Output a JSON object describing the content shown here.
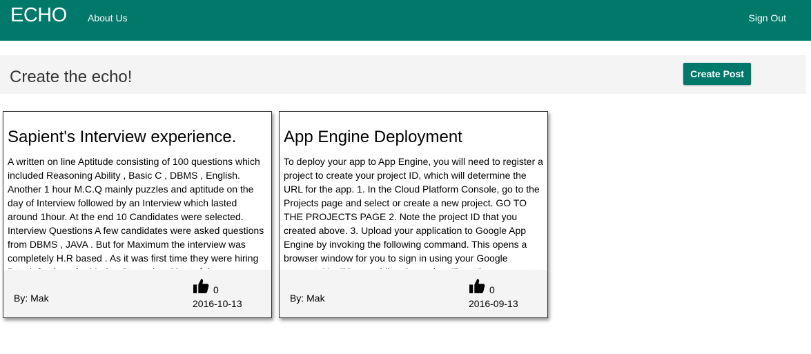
{
  "navbar": {
    "brand": "ECHO",
    "about_label": "About Us",
    "signout_label": "Sign Out",
    "color": "#00796b"
  },
  "header": {
    "title": "Create the echo!",
    "create_label": "Create Post"
  },
  "posts": [
    {
      "title": "Sapient's Interview experience.",
      "body": "A written on line Aptitude consisting of 100 questions which included Reasoning Ability , Basic C , DBMS , English. Another 1 hour M.C.Q mainly puzzles and aptitude on the day of Interview followed by an Interview which lasted around 1hour. At the end 10 Candidates were selected. Interview Questions A few candidates were asked questions from DBMS , JAVA . But for Maximum the interview was completely H.R based . As it was first time they were hiring B.tech freshers for Market Strategies. Most of the",
      "author": "By: Mak",
      "likes": "0",
      "date": "2016-10-13",
      "like_icon": "thumbs-up-icon"
    },
    {
      "title": "App Engine Deployment",
      "body": "To deploy your app to App Engine, you will need to register a project to create your project ID, which will determine the URL for the app. 1. In the Cloud Platform Console, go to the Projects page and select or create a new project. GO TO THE PROJECTS PAGE 2. Note the project ID that you created above. 3. Upload your application to Google App Engine by invoking the following command. This opens a browser window for you to sign in using your Google account. You'll be providing the project ID as the argument",
      "author": "By: Mak",
      "likes": "0",
      "date": "2016-09-13",
      "like_icon": "thumbs-up-icon"
    }
  ]
}
